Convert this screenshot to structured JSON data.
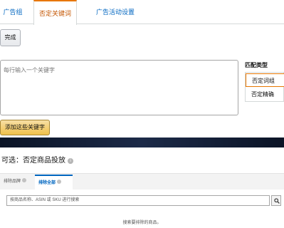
{
  "tabs": [
    {
      "label": "广告组"
    },
    {
      "label": "否定关键词"
    },
    {
      "label": "广告活动设置"
    }
  ],
  "done_button": "完成",
  "keywords": {
    "placeholder": "每行输入一个关键字"
  },
  "match_type": {
    "title": "匹配类型",
    "options": [
      {
        "label": "否定词组"
      },
      {
        "label": "否定精确"
      }
    ]
  },
  "add_button": "添加这些关键字",
  "product_targeting": {
    "title": "可选：否定商品投放",
    "tabs": [
      {
        "label": "排除品牌"
      },
      {
        "label": "排除全部"
      }
    ],
    "search_placeholder": "按商品名称、ASIN 或 SKU 进行搜索",
    "empty_message": "搜索要排除的商品。"
  },
  "colors": {
    "accent_orange": "#e77600",
    "link_blue": "#0066c0",
    "primary_button": "#f0c14b"
  }
}
